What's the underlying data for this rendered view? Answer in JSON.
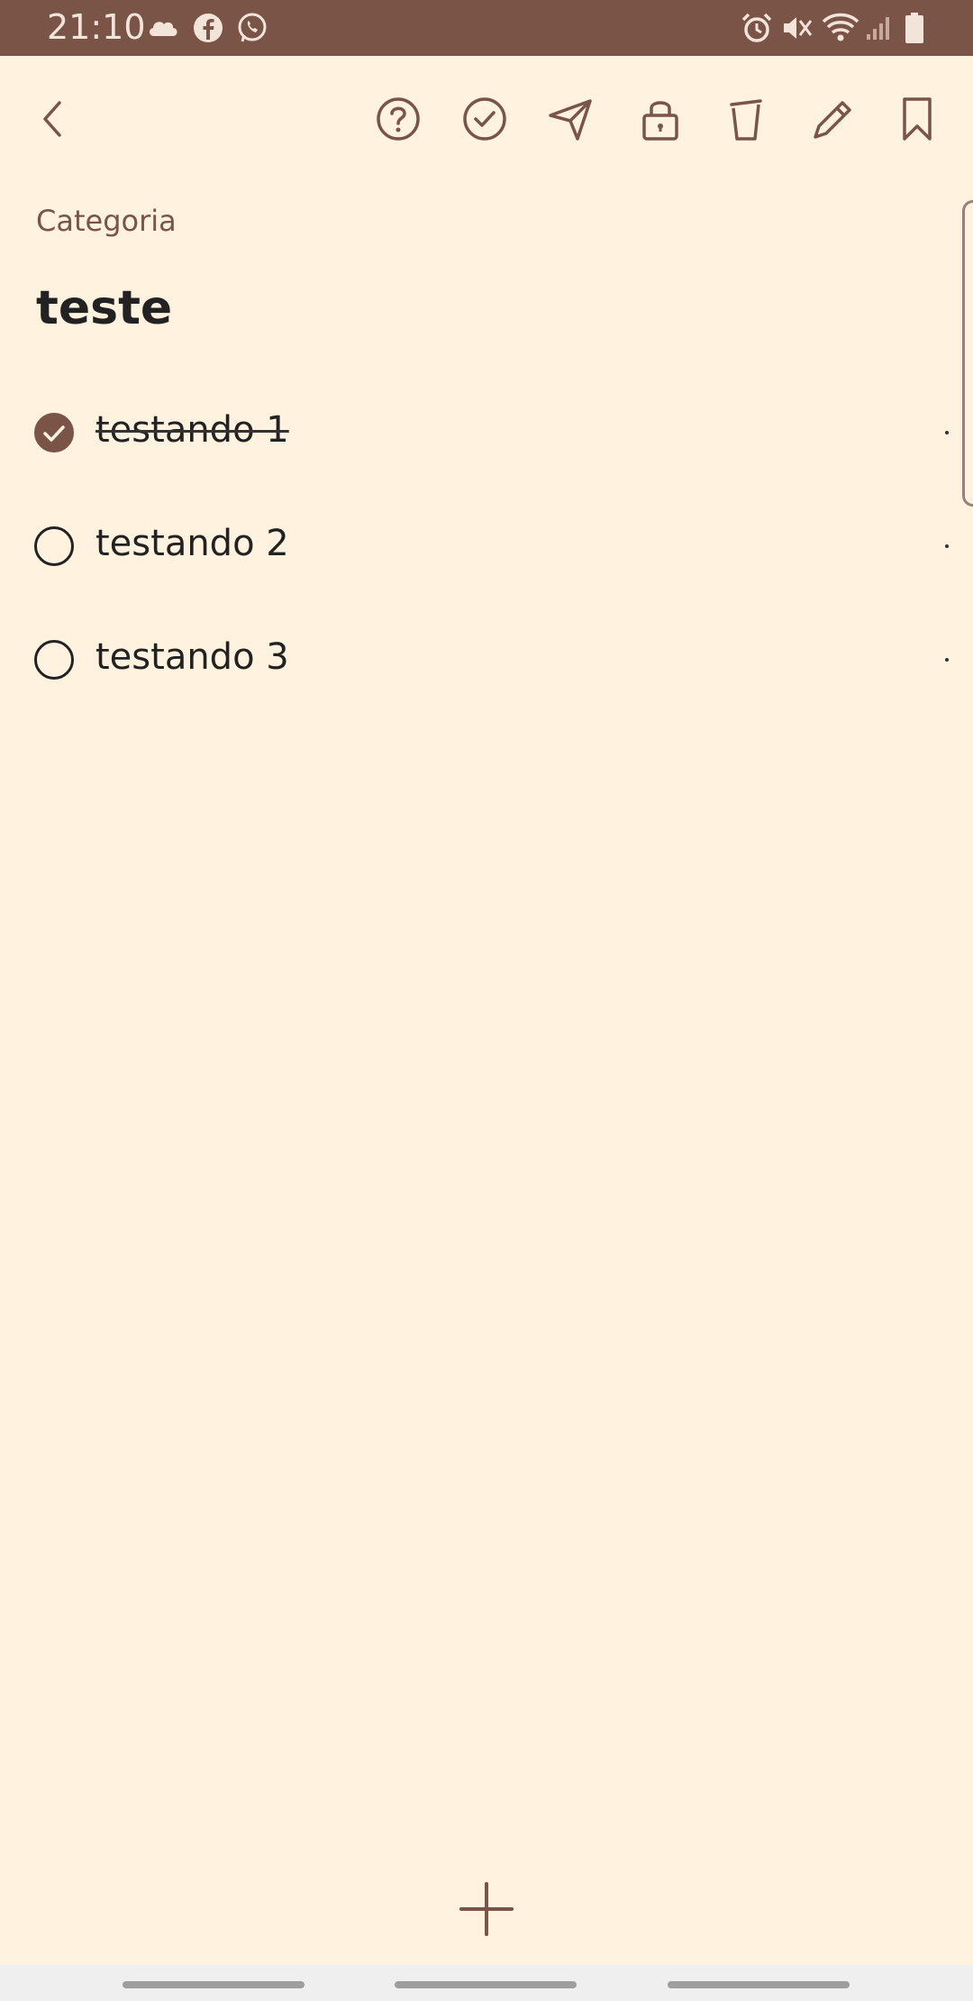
{
  "status_bar": {
    "time": "21:10",
    "left_icons": [
      "cloud-icon",
      "facebook-icon",
      "whatsapp-icon"
    ],
    "right_icons": [
      "alarm-icon",
      "mute-icon",
      "wifi-icon",
      "signal-icon",
      "battery-icon"
    ],
    "background": "#7a5446"
  },
  "toolbar": {
    "icons": [
      "back-icon",
      "help-icon",
      "check-circle-icon",
      "send-icon",
      "lock-icon",
      "trash-icon",
      "edit-icon",
      "bookmark-icon"
    ]
  },
  "note": {
    "category": "Categoria",
    "title": "teste",
    "items": [
      {
        "text": "testando 1",
        "checked": true
      },
      {
        "text": "testando 2",
        "checked": false
      },
      {
        "text": "testando 3",
        "checked": false
      }
    ]
  },
  "fab": {
    "icon": "plus-icon"
  },
  "colors": {
    "accent": "#7a5446",
    "background": "#fff2df",
    "text": "#222222"
  }
}
